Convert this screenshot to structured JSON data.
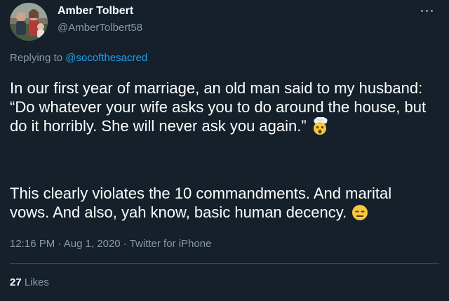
{
  "author": {
    "display_name": "Amber Tolbert",
    "handle": "@AmberTolbert58",
    "avatar_icon": "profile-photo"
  },
  "reply": {
    "prefix": "Replying to ",
    "mention": "@socofthesacred"
  },
  "tweet": {
    "paragraph_1": "In our first year of marriage, an old man said to my husband: “Do whatever your wife asks you to do around the house, but do it horribly. She will never ask you again.”",
    "paragraph_1_emoji": "exploding-head-emoji",
    "paragraph_2": "This clearly violates the 10 commandments. And marital vows. And also, yah know, basic human decency.",
    "paragraph_2_emoji": "expressionless-face-emoji"
  },
  "meta": {
    "time": "12:16 PM",
    "separator": " · ",
    "date": "Aug 1, 2020",
    "source": "Twitter for iPhone"
  },
  "stats": {
    "likes_count": "27",
    "likes_label": "Likes"
  },
  "colors": {
    "background": "#15202b",
    "secondary_text": "#8899a6",
    "link": "#1da1f2",
    "divider": "#38444d"
  }
}
